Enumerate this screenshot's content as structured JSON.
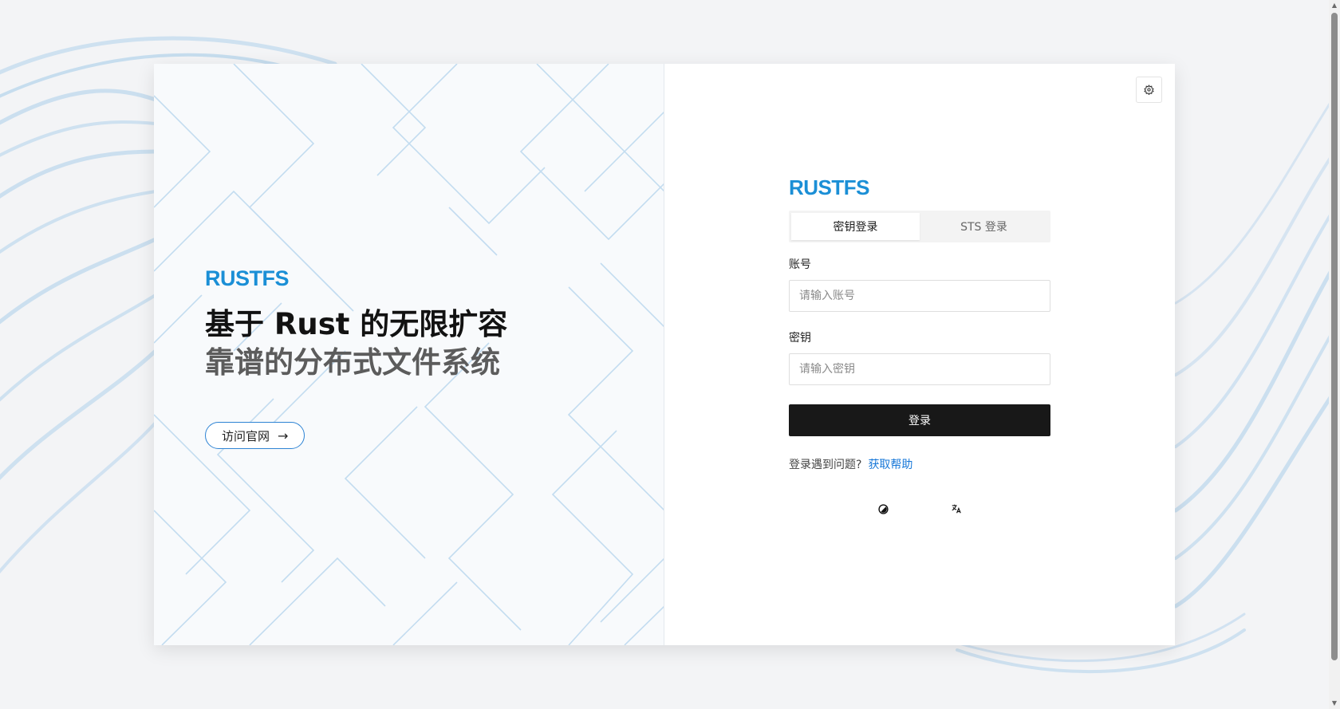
{
  "brand": {
    "logo": "RUSTFS",
    "color": "#1b8fd6"
  },
  "hero": {
    "headline": "基于 Rust 的无限扩容",
    "subheadline": "靠谱的分布式文件系统",
    "visit_button": "访问官网",
    "visit_arrow": "→"
  },
  "settings": {
    "icon": "gear-icon"
  },
  "login": {
    "tabs": [
      {
        "label": "密钥登录",
        "active": true
      },
      {
        "label": "STS 登录",
        "active": false
      }
    ],
    "account_label": "账号",
    "account_placeholder": "请输入账号",
    "secret_label": "密钥",
    "secret_placeholder": "请输入密钥",
    "submit_label": "登录",
    "help_text": "登录遇到问题?",
    "help_link": "获取帮助"
  },
  "footer_icons": [
    "theme-toggle-icon",
    "language-icon"
  ],
  "colors": {
    "accent": "#1b8fd6",
    "link": "#1677d8",
    "button": "#181818",
    "background": "#f3f4f6"
  }
}
